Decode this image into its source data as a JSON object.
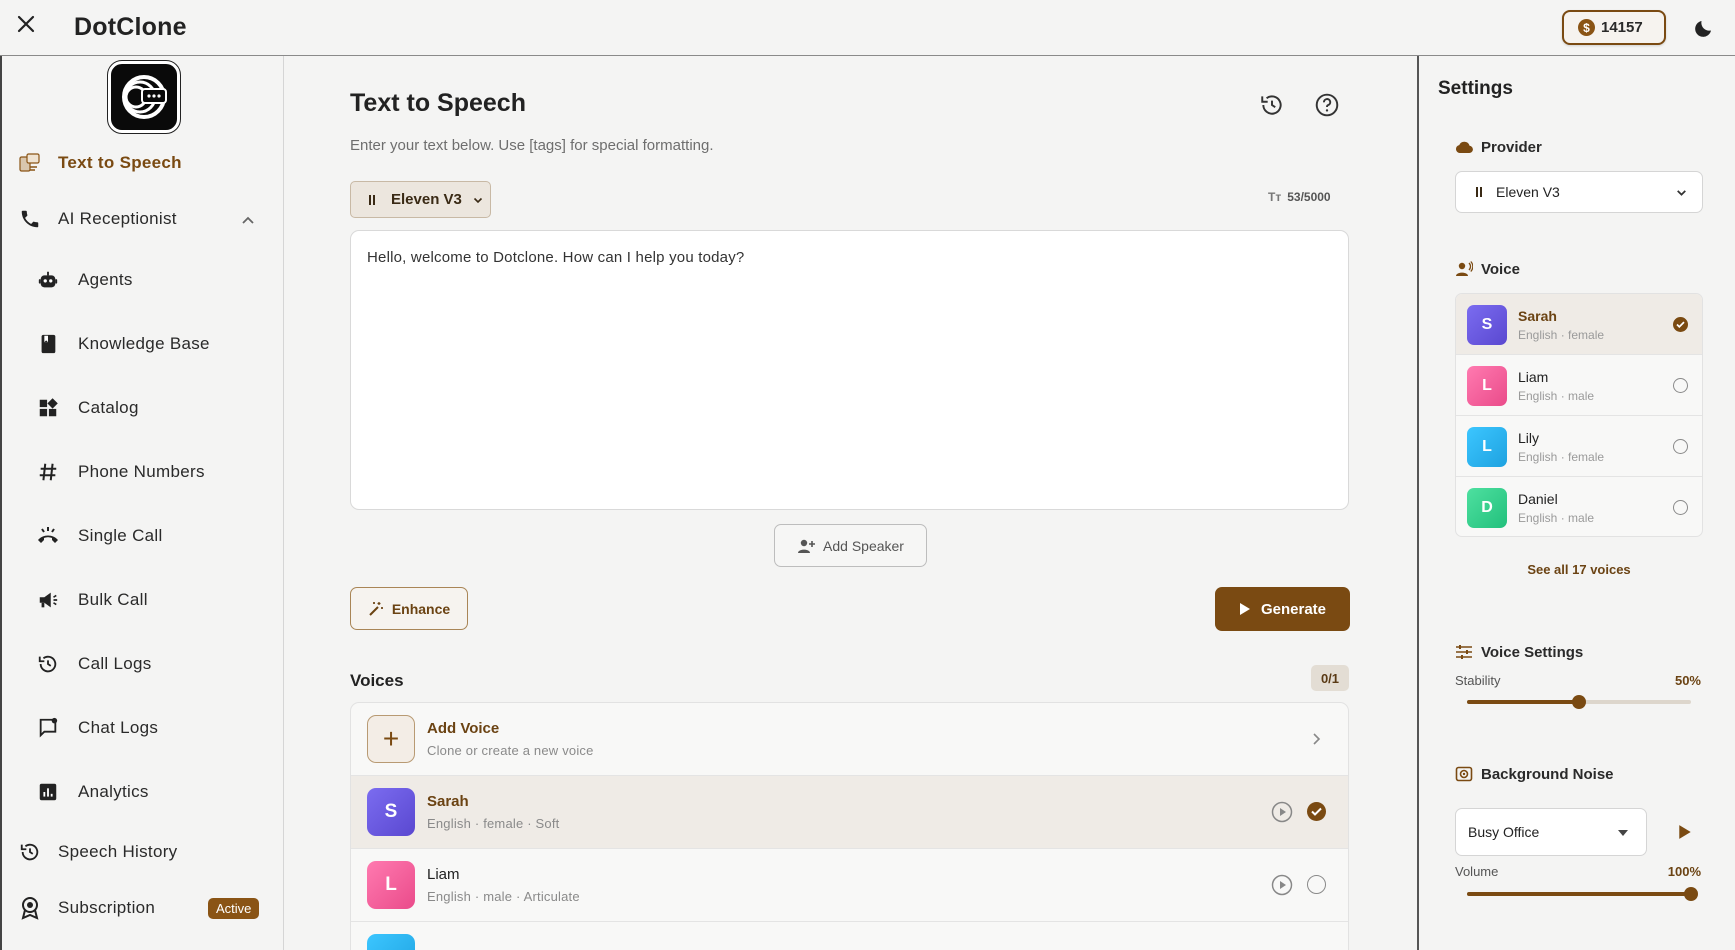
{
  "app": {
    "title": "DotClone"
  },
  "header": {
    "coins": "14157",
    "coin_symbol": "$"
  },
  "sidebar": {
    "items": [
      {
        "label": "Text to Speech"
      },
      {
        "label": "AI Receptionist"
      },
      {
        "label": "Agents"
      },
      {
        "label": "Knowledge Base"
      },
      {
        "label": "Catalog"
      },
      {
        "label": "Phone Numbers"
      },
      {
        "label": "Single Call"
      },
      {
        "label": "Bulk Call"
      },
      {
        "label": "Call Logs"
      },
      {
        "label": "Chat Logs"
      },
      {
        "label": "Analytics"
      },
      {
        "label": "Speech History"
      },
      {
        "label": "Subscription",
        "badge": "Active"
      }
    ]
  },
  "main": {
    "title": "Text to Speech",
    "subtitle": "Enter your text below. Use [tags] for special formatting.",
    "model": "Eleven V3",
    "char_count": "53/5000",
    "char_count_icon": "Tт",
    "text": "Hello, welcome to Dotclone. How can I help you today?",
    "add_speaker_label": "Add Speaker",
    "enhance_label": "Enhance",
    "generate_label": "Generate",
    "voices_title": "Voices",
    "voices_count": "0/1",
    "add_voice": {
      "name": "Add Voice",
      "desc": "Clone or create a new voice",
      "plus": "+"
    },
    "voices": [
      {
        "initial": "S",
        "name": "Sarah",
        "desc": "English · female · Soft",
        "selected": true
      },
      {
        "initial": "L",
        "name": "Liam",
        "desc": "English · male · Articulate",
        "selected": false
      }
    ]
  },
  "settings": {
    "title": "Settings",
    "provider_label": "Provider",
    "provider_value": "Eleven V3",
    "voice_label": "Voice",
    "voices": [
      {
        "initial": "S",
        "name": "Sarah",
        "desc": "English · female",
        "selected": true
      },
      {
        "initial": "L",
        "name": "Liam",
        "desc": "English · male",
        "selected": false
      },
      {
        "initial": "L",
        "name": "Lily",
        "desc": "English · female",
        "selected": false
      },
      {
        "initial": "D",
        "name": "Daniel",
        "desc": "English · male",
        "selected": false
      }
    ],
    "see_all": "See all 17 voices",
    "voice_settings_label": "Voice Settings",
    "stability_label": "Stability",
    "stability_value": "50%",
    "stability_level": 0.5,
    "bg_noise_label": "Background Noise",
    "bg_noise_value": "Busy Office",
    "volume_label": "Volume",
    "volume_value": "100%",
    "volume_level": 1.0
  },
  "colors": {
    "accent": "#7a4a12",
    "sarah": "#6a5ae0",
    "liam": "#f0609a",
    "lily": "#2bb6f0",
    "daniel": "#2fd08c"
  }
}
